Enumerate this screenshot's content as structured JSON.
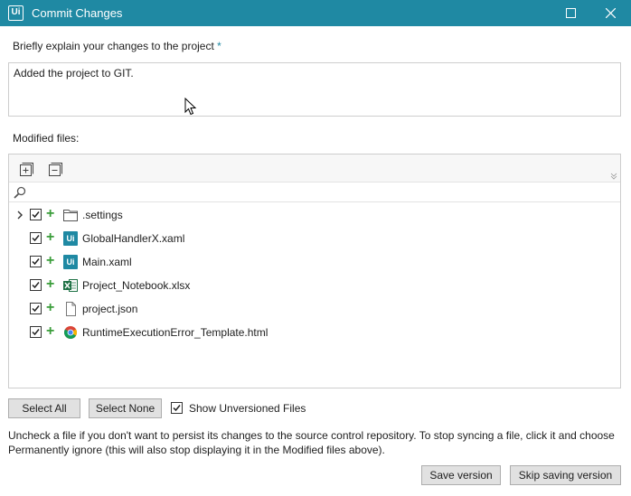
{
  "window": {
    "logo_text": "Ui",
    "title": "Commit Changes"
  },
  "description": {
    "label": "Briefly explain your changes to the project",
    "required_marker": "*",
    "value": "Added the project to GIT."
  },
  "modified_files": {
    "label": "Modified files:",
    "files": [
      {
        "name": ".settings",
        "icon": "folder-icon",
        "checked": true,
        "status": "added",
        "expandable": true
      },
      {
        "name": "GlobalHandlerX.xaml",
        "icon": "uipath-file-icon",
        "icon_text": "Ui",
        "checked": true,
        "status": "added"
      },
      {
        "name": "Main.xaml",
        "icon": "uipath-file-icon",
        "icon_text": "Ui",
        "checked": true,
        "status": "added"
      },
      {
        "name": "Project_Notebook.xlsx",
        "icon": "excel-file-icon",
        "checked": true,
        "status": "added"
      },
      {
        "name": "project.json",
        "icon": "document-file-icon",
        "checked": true,
        "status": "added"
      },
      {
        "name": "RuntimeExecutionError_Template.html",
        "icon": "chrome-file-icon",
        "checked": true,
        "status": "added"
      }
    ],
    "status_symbol": "+"
  },
  "actions": {
    "select_all": "Select All",
    "select_none": "Select None",
    "show_unversioned_label": "Show Unversioned Files",
    "show_unversioned_checked": true
  },
  "info_text": "Uncheck a file if you don't want to persist its changes to the source control repository. To stop syncing a file, click it and choose Permanently ignore (this will also stop displaying it in the Modified files above).",
  "footer": {
    "save_version": "Save version",
    "skip_saving": "Skip saving version"
  },
  "colors": {
    "titlebar": "#1f89a3",
    "added_status": "#3a9d3a",
    "excel": "#1e7145"
  }
}
